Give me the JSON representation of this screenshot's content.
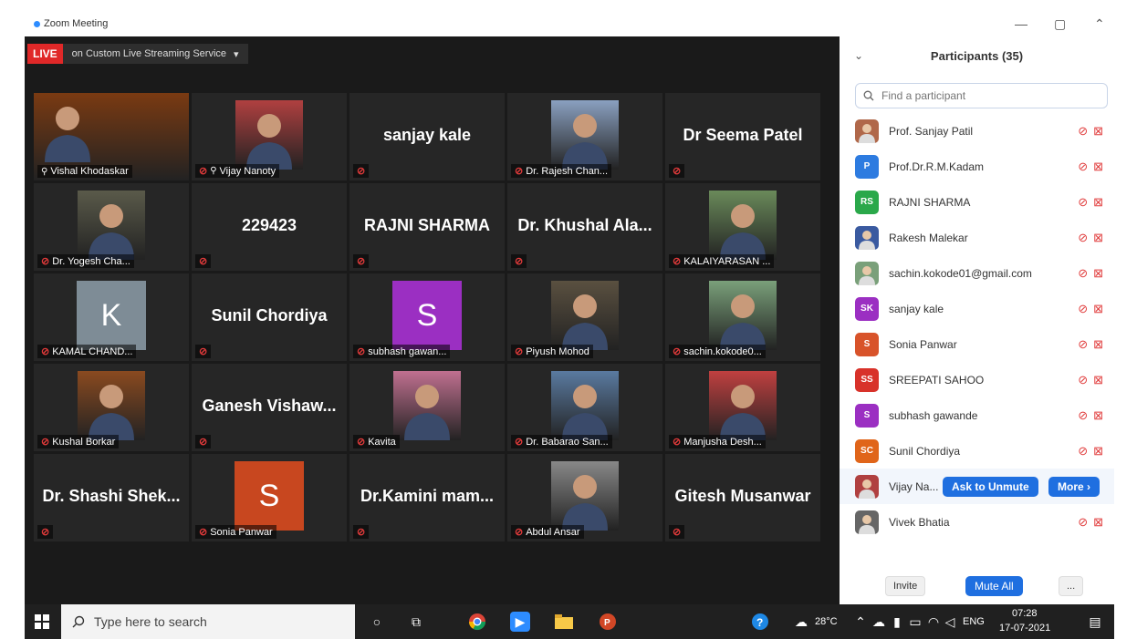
{
  "window": {
    "title": "Zoom Meeting"
  },
  "live": {
    "badge": "LIVE",
    "service": "on Custom Live Streaming Service",
    "caret": "▾"
  },
  "tiles": [
    {
      "type": "photo",
      "label": "Vishal Khodaskar",
      "active": true,
      "pinned": true,
      "muted": false,
      "bg": "#7a3a12"
    },
    {
      "type": "photo",
      "label": "Vijay Nanoty",
      "pinned": true,
      "muted": true,
      "bg": "#b04040"
    },
    {
      "type": "text",
      "name": "sanjay kale",
      "muted": true
    },
    {
      "type": "photo",
      "label": "Dr. Rajesh Chan...",
      "muted": true,
      "bg": "#8aa0c0"
    },
    {
      "type": "text",
      "name": "Dr Seema Patel",
      "muted": true
    },
    {
      "type": "photo",
      "label": "Dr. Yogesh Cha...",
      "muted": true,
      "bg": "#5a5a4a"
    },
    {
      "type": "text",
      "name": "229423",
      "muted": true
    },
    {
      "type": "text",
      "name": "RAJNI SHARMA",
      "muted": true
    },
    {
      "type": "text",
      "name": "Dr. Khushal Ala...",
      "muted": true
    },
    {
      "type": "photo",
      "label": "KALAIYARASAN ...",
      "muted": true,
      "bg": "#6a8a5a"
    },
    {
      "type": "avatar",
      "initial": "K",
      "color": "#7e8c96",
      "label": "KAMAL CHAND...",
      "muted": true
    },
    {
      "type": "text",
      "name": "Sunil Chordiya",
      "muted": true
    },
    {
      "type": "avatar",
      "initial": "S",
      "color": "#9b2fc2",
      "label": "subhash gawan...",
      "muted": true
    },
    {
      "type": "photo",
      "label": "Piyush Mohod",
      "muted": true,
      "bg": "#5a5040"
    },
    {
      "type": "photo",
      "label": "sachin.kokode0...",
      "muted": true,
      "bg": "#7aa07a"
    },
    {
      "type": "photo",
      "label": "Kushal Borkar",
      "muted": true,
      "bg": "#8a4a20"
    },
    {
      "type": "text",
      "name": "Ganesh  Vishaw...",
      "muted": true
    },
    {
      "type": "photo",
      "label": "Kavita",
      "muted": true,
      "bg": "#c07090"
    },
    {
      "type": "photo",
      "label": "Dr. Babarao San...",
      "muted": true,
      "bg": "#5a7aa0"
    },
    {
      "type": "photo",
      "label": "Manjusha Desh...",
      "muted": true,
      "bg": "#c04040"
    },
    {
      "type": "text",
      "name": "Dr. Shashi Shek...",
      "muted": true
    },
    {
      "type": "avatar",
      "initial": "S",
      "color": "#c8471f",
      "label": "Sonia Panwar",
      "muted": true
    },
    {
      "type": "text",
      "name": "Dr.Kamini  mam...",
      "muted": true
    },
    {
      "type": "photo",
      "label": "Abdul Ansar",
      "muted": true,
      "bg": "#888888"
    },
    {
      "type": "text",
      "name": "Gitesh Musanwar",
      "muted": true
    }
  ],
  "panel": {
    "title": "Participants (35)",
    "search_placeholder": "Find a participant",
    "participants": [
      {
        "name": "Prof. Sanjay Patil",
        "avatar": "photo",
        "color": "#b0684a"
      },
      {
        "name": "Prof.Dr.R.M.Kadam",
        "avatar": "P",
        "color": "#2d7be0"
      },
      {
        "name": "RAJNI SHARMA",
        "avatar": "RS",
        "color": "#2aa84a"
      },
      {
        "name": "Rakesh Malekar",
        "avatar": "photo",
        "color": "#3a5aa0"
      },
      {
        "name": "sachin.kokode01@gmail.com",
        "avatar": "photo",
        "color": "#7aa07a"
      },
      {
        "name": "sanjay kale",
        "avatar": "SK",
        "color": "#9b2fc2"
      },
      {
        "name": "Sonia Panwar",
        "avatar": "S",
        "color": "#d8532a"
      },
      {
        "name": "SREEPATI SAHOO",
        "avatar": "SS",
        "color": "#d8322a"
      },
      {
        "name": "subhash gawande",
        "avatar": "S",
        "color": "#9b2fc2"
      },
      {
        "name": "Sunil Chordiya",
        "avatar": "SC",
        "color": "#e0651a"
      },
      {
        "name": "Vijay Na...",
        "avatar": "photo",
        "color": "#b04040",
        "highlight": true
      },
      {
        "name": "Vivek Bhatia",
        "avatar": "photo",
        "color": "#666666"
      }
    ],
    "ask_to_unmute": "Ask to Unmute",
    "more": "More ›",
    "invite": "Invite",
    "mute_all": "Mute All",
    "ellipsis": "..."
  },
  "taskbar": {
    "search_placeholder": "Type here to search",
    "temperature": "28°C",
    "language": "ENG",
    "time": "07:28",
    "date": "17-07-2021"
  }
}
